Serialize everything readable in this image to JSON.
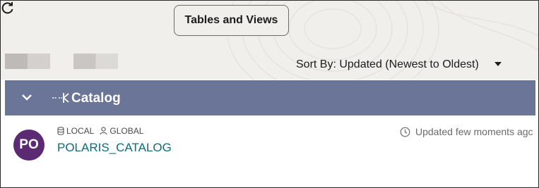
{
  "toolbar": {
    "tab_label": "Tables and Views",
    "sort_label": "Sort By: Updated (Newest to Oldest)"
  },
  "icons": {
    "sort_caret": "caret-down-icon",
    "refresh": "refresh-icon",
    "collapse": "chevron-down-icon",
    "catalog": "catalog-link-icon",
    "local": "database-icon",
    "global": "person-icon",
    "clock": "clock-icon"
  },
  "group": {
    "title": "Catalog",
    "header_color": "#6b7597"
  },
  "catalog_item": {
    "avatar_initials": "PO",
    "avatar_color": "#5c2a73",
    "tag_local": "LOCAL",
    "tag_global": "GLOBAL",
    "name": "POLARIS_CATALOG",
    "name_color": "#0e6b7f",
    "updated": "Updated few moments agc"
  }
}
